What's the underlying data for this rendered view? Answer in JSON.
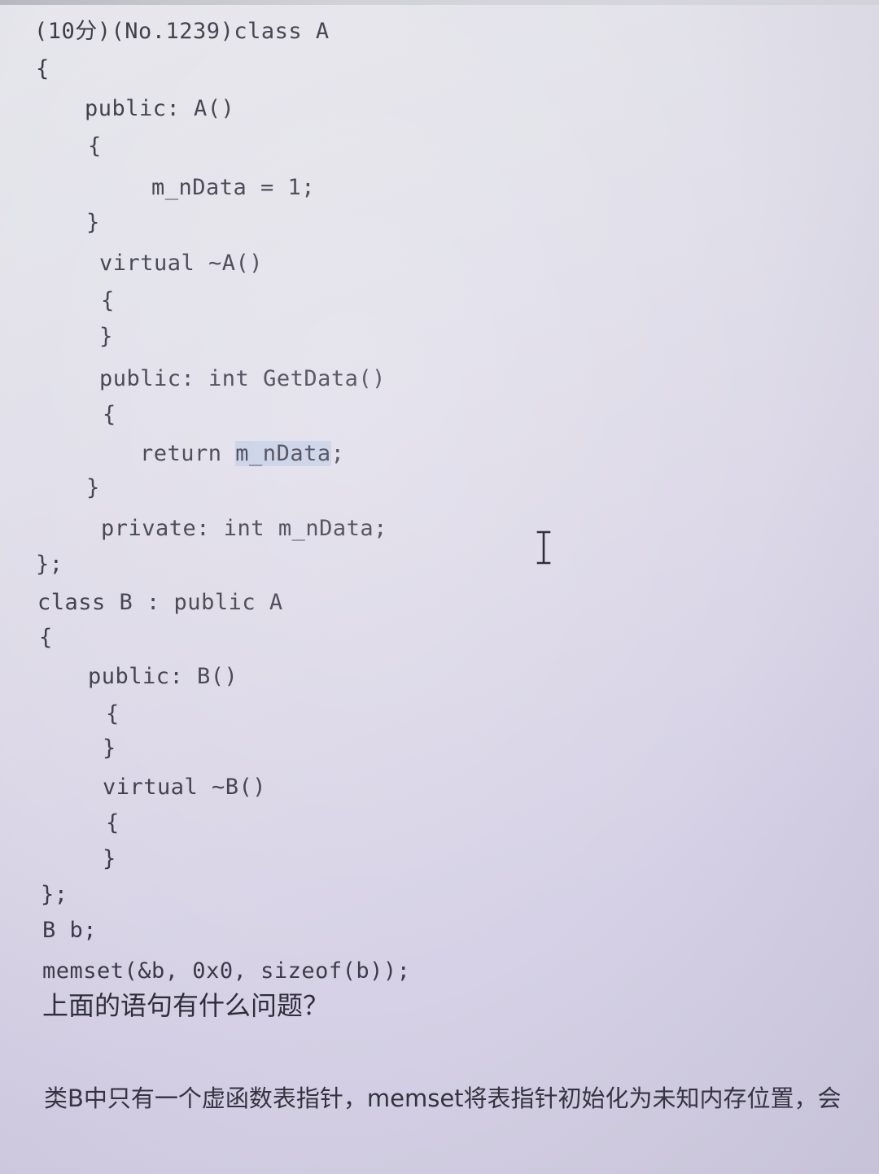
{
  "code_lines": [
    "(10分)(No.1239)class A",
    "{",
    "public: A()",
    "{",
    "m_nData = 1;",
    "}",
    "virtual ~A()",
    "{",
    "}",
    "public: int GetData()",
    "{",
    "return ",
    "m_nData",
    ";",
    "}",
    "private: int m_nData;",
    "};",
    "class B : public A",
    "{",
    "public: B()",
    "{",
    "}",
    "virtual ~B()",
    "{",
    "}",
    "};",
    "B b;",
    "memset(&b, 0x0, sizeof(b));"
  ],
  "question": "上面的语句有什么问题？",
  "answer": "类B中只有一个虚函数表指针，memset将表指针初始化为未知内存位置，会",
  "cursor_icon": "i-beam-text-cursor-icon"
}
